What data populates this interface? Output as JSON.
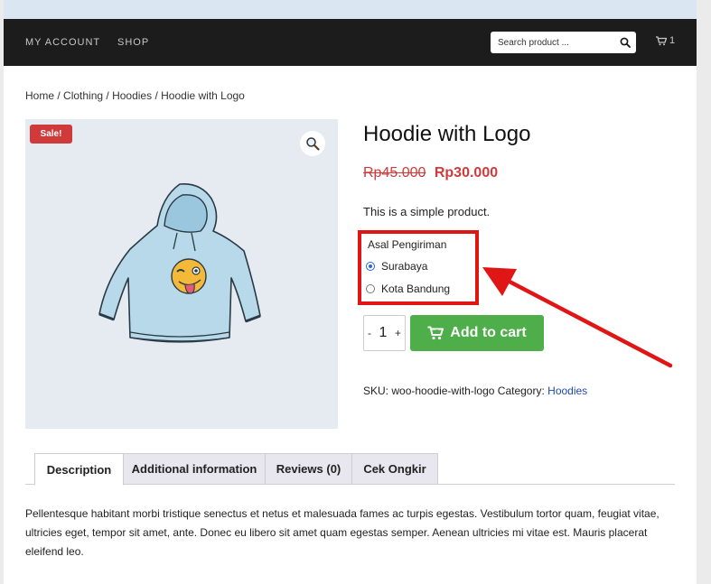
{
  "nav": {
    "my_account": "MY ACCOUNT",
    "shop": "SHOP",
    "search_placeholder": "Search product ...",
    "cart_count": "1"
  },
  "breadcrumb": {
    "home": "Home",
    "sep": " / ",
    "clothing": "Clothing",
    "hoodies": "Hoodies",
    "current": "Hoodie with Logo"
  },
  "gallery": {
    "sale_badge": "Sale!"
  },
  "product": {
    "title": "Hoodie with Logo",
    "price_old": "Rp45.000",
    "price_new": "Rp30.000",
    "short_description": "This is a simple product.",
    "shipping_origin": {
      "label": "Asal Pengiriman",
      "options": [
        "Surabaya",
        "Kota Bandung"
      ],
      "selected": "Surabaya"
    },
    "quantity": "1",
    "qty_minus": "-",
    "qty_plus": "+",
    "add_to_cart": "Add to cart",
    "sku_label": "SKU:",
    "sku": "woo-hoodie-with-logo",
    "category_label": "Category:",
    "category": "Hoodies"
  },
  "tabs": [
    "Description",
    "Additional information",
    "Reviews (0)",
    "Cek Ongkir"
  ],
  "description": "Pellentesque habitant morbi tristique senectus et netus et malesuada fames ac turpis egestas. Vestibulum tortor quam, feugiat vitae, ultricies eget, tempor sit amet, ante. Donec eu libero sit amet quam egestas semper. Aenean ultricies mi vitae est. Mauris placerat eleifend leo.",
  "colors": {
    "nav_bg": "#1c1c1c",
    "sale_red": "#d13a3a",
    "add_to_cart_green": "#4dae4a",
    "annotation_red": "#e01616",
    "link_blue": "#1f4ba5"
  }
}
